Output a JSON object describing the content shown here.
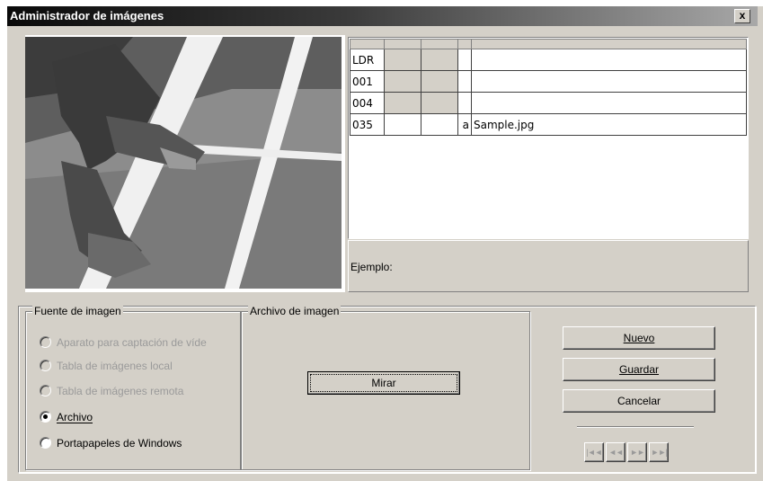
{
  "window": {
    "title": "Administrador de imágenes",
    "close_label": "x"
  },
  "grid": {
    "rows": [
      {
        "tag": "LDR",
        "i1": "",
        "i2": "",
        "code": "",
        "value": ""
      },
      {
        "tag": "001",
        "i1": "",
        "i2": "",
        "code": "",
        "value": ""
      },
      {
        "tag": "004",
        "i1": "",
        "i2": "",
        "code": "",
        "value": ""
      },
      {
        "tag": "035",
        "i1": "",
        "i2": "",
        "code": "a",
        "value": "Sample.jpg"
      }
    ]
  },
  "example_label": "Ejemplo:",
  "source": {
    "legend": "Fuente de imagen",
    "options": [
      {
        "label": "Aparato para captación de víde",
        "enabled": false,
        "selected": false
      },
      {
        "label": "Tabla de imágenes local",
        "enabled": false,
        "selected": false
      },
      {
        "label": "Tabla de imágenes remota",
        "enabled": false,
        "selected": false
      },
      {
        "label": "Archivo",
        "enabled": true,
        "selected": true
      },
      {
        "label": "Portapapeles de Windows",
        "enabled": true,
        "selected": false
      }
    ]
  },
  "file": {
    "legend": "Archivo de imagen",
    "browse_label": "Mirar"
  },
  "actions": {
    "new_label": "Nuevo",
    "save_label": "Guardar",
    "cancel_label": "Cancelar"
  },
  "nav": {
    "first": "|◄◄",
    "prev": "◄◄",
    "next": "►►",
    "last": "►►|"
  }
}
